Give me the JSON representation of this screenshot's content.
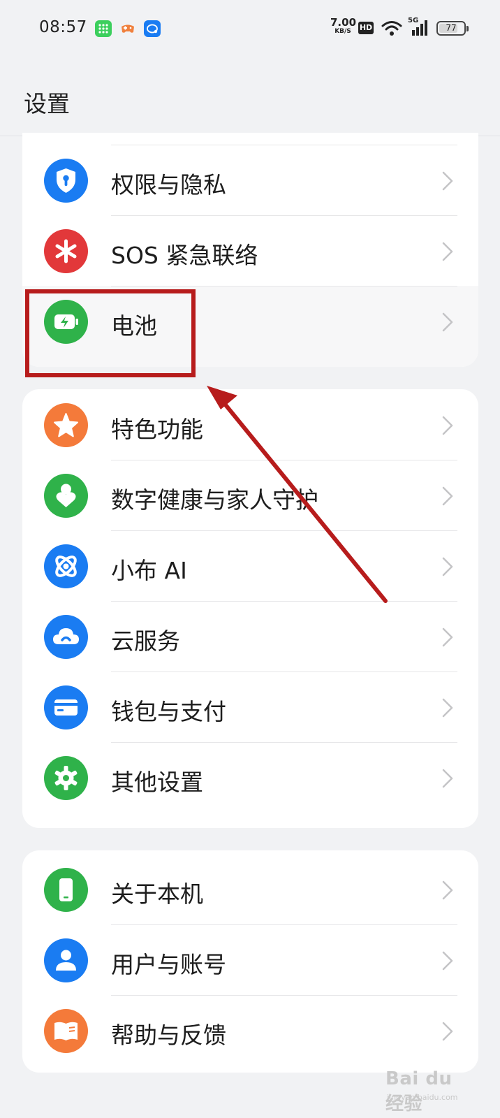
{
  "status_bar": {
    "time": "08:57",
    "net_speed_value": "7.00",
    "net_speed_unit": "KB/S",
    "hd_label": "HD",
    "network_label": "5G",
    "battery_level": "77"
  },
  "header": {
    "title": "设置"
  },
  "groups": [
    {
      "items": [
        {
          "label": "权限与隐私",
          "icon": "shield-lock-icon",
          "color": "#1a7cf2"
        },
        {
          "label": "SOS 紧急联络",
          "icon": "asterisk-icon",
          "color": "#e2383a"
        },
        {
          "label": "电池",
          "icon": "battery-charging-icon",
          "color": "#2fb24a"
        }
      ]
    },
    {
      "items": [
        {
          "label": "特色功能",
          "icon": "star-icon",
          "color": "#f47a3a"
        },
        {
          "label": "数字健康与家人守护",
          "icon": "person-heart-icon",
          "color": "#2fb24a"
        },
        {
          "label": "小布 AI",
          "icon": "ai-orbit-icon",
          "color": "#1a7cf2"
        },
        {
          "label": "云服务",
          "icon": "cloud-icon",
          "color": "#1a7cf2"
        },
        {
          "label": "钱包与支付",
          "icon": "card-icon",
          "color": "#1a7cf2"
        },
        {
          "label": "其他设置",
          "icon": "gear-icon",
          "color": "#2fb24a"
        }
      ]
    },
    {
      "items": [
        {
          "label": "关于本机",
          "icon": "phone-icon",
          "color": "#2fb24a"
        },
        {
          "label": "用户与账号",
          "icon": "user-icon",
          "color": "#1a7cf2"
        },
        {
          "label": "帮助与反馈",
          "icon": "book-icon",
          "color": "#f47a3a"
        }
      ]
    }
  ],
  "annotation": {
    "color": "#b71c1c"
  },
  "watermark": {
    "main": "Bai du 经验",
    "sub": "jingyan.baidu.com"
  }
}
